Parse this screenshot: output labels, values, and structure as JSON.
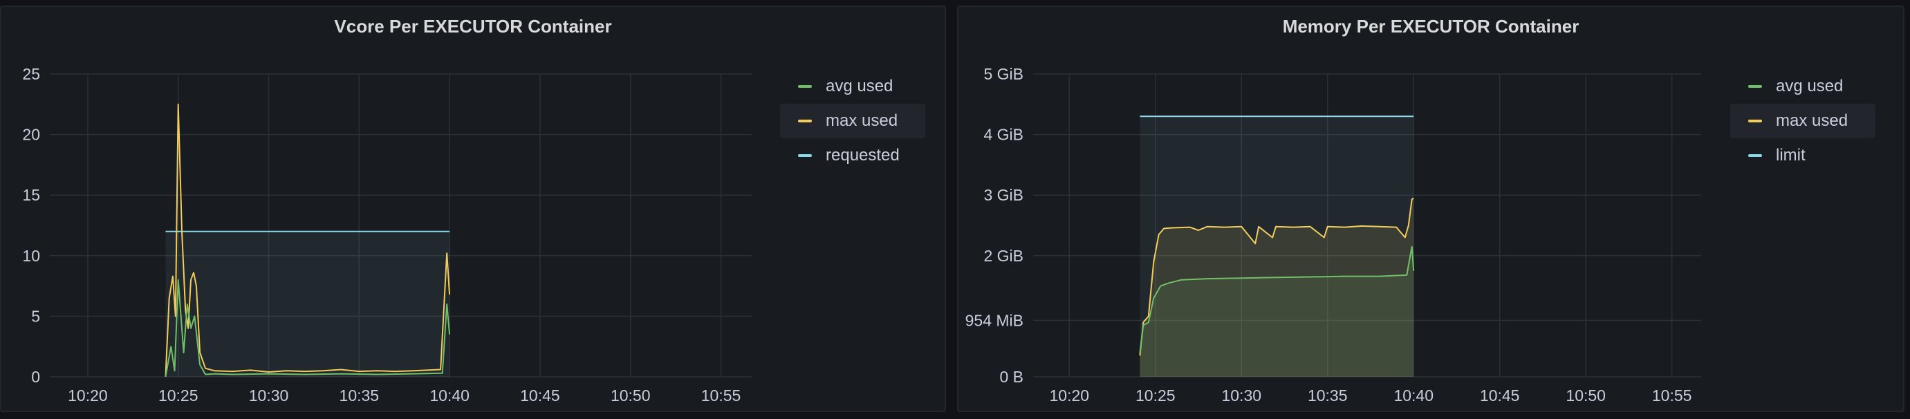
{
  "colors": {
    "avg": "#73bf69",
    "max": "#f2cc5c",
    "limit": "#8ad9e8",
    "grid": "#2c2f36",
    "text": "#ccccdc"
  },
  "chart_data": [
    {
      "type": "line",
      "title": "Vcore Per EXECUTOR Container",
      "xlabel": "",
      "ylabel": "",
      "x_ticks": [
        "10:20",
        "10:25",
        "10:30",
        "10:35",
        "10:40",
        "10:45",
        "10:50",
        "10:55"
      ],
      "y_ticks": [
        "0",
        "5",
        "10",
        "15",
        "20",
        "25"
      ],
      "ylim": [
        0,
        25
      ],
      "x_range_minutes": [
        10.2,
        10.25,
        10.3,
        10.35,
        10.4,
        10.45,
        10.5,
        10.55
      ],
      "legend_position": "right",
      "grid": true,
      "series": [
        {
          "name": "avg used",
          "color_key": "avg",
          "points": [
            [
              "10:24.3",
              0
            ],
            [
              "10:24.6",
              2.5
            ],
            [
              "10:24.8",
              0.5
            ],
            [
              "10:25.0",
              8
            ],
            [
              "10:25.3",
              2
            ],
            [
              "10:25.5",
              6
            ],
            [
              "10:25.7",
              4
            ],
            [
              "10:25.9",
              5
            ],
            [
              "10:26.2",
              1
            ],
            [
              "10:26.5",
              0.2
            ],
            [
              "10:27.0",
              0.25
            ],
            [
              "10:28.0",
              0.2
            ],
            [
              "10:30.0",
              0.25
            ],
            [
              "10:32.0",
              0.2
            ],
            [
              "10:34.0",
              0.25
            ],
            [
              "10:36.0",
              0.2
            ],
            [
              "10:38.0",
              0.25
            ],
            [
              "10:39.6",
              0.3
            ],
            [
              "10:39.85",
              6
            ],
            [
              "10:40.0",
              3.5
            ]
          ]
        },
        {
          "name": "max used",
          "color_key": "max",
          "points": [
            [
              "10:24.3",
              0
            ],
            [
              "10:24.5",
              6.5
            ],
            [
              "10:24.7",
              8.3
            ],
            [
              "10:24.85",
              5
            ],
            [
              "10:25.0",
              22.5
            ],
            [
              "10:25.2",
              12
            ],
            [
              "10:25.4",
              5.5
            ],
            [
              "10:25.55",
              4
            ],
            [
              "10:25.7",
              8
            ],
            [
              "10:25.85",
              8.6
            ],
            [
              "10:26.0",
              7.5
            ],
            [
              "10:26.2",
              2
            ],
            [
              "10:26.5",
              0.7
            ],
            [
              "10:27.0",
              0.5
            ],
            [
              "10:28.0",
              0.45
            ],
            [
              "10:29.0",
              0.55
            ],
            [
              "10:30.0",
              0.4
            ],
            [
              "10:31.0",
              0.5
            ],
            [
              "10:32.0",
              0.45
            ],
            [
              "10:33.0",
              0.5
            ],
            [
              "10:34.0",
              0.6
            ],
            [
              "10:35.0",
              0.45
            ],
            [
              "10:36.0",
              0.5
            ],
            [
              "10:37.0",
              0.45
            ],
            [
              "10:38.0",
              0.5
            ],
            [
              "10:39.5",
              0.6
            ],
            [
              "10:39.85",
              10.2
            ],
            [
              "10:40.0",
              6.8
            ]
          ]
        },
        {
          "name": "requested",
          "color_key": "limit",
          "fill": true,
          "points": [
            [
              "10:24.3",
              12
            ],
            [
              "10:40.0",
              12
            ]
          ]
        }
      ]
    },
    {
      "type": "line",
      "title": "Memory Per EXECUTOR Container",
      "xlabel": "",
      "ylabel": "",
      "x_ticks": [
        "10:20",
        "10:25",
        "10:30",
        "10:35",
        "10:40",
        "10:45",
        "10:50",
        "10:55"
      ],
      "y_ticks": [
        "0 B",
        "954 MiB",
        "2 GiB",
        "3 GiB",
        "4 GiB",
        "5 GiB"
      ],
      "ylim": [
        0,
        5
      ],
      "y_unit": "GiB",
      "legend_position": "right",
      "grid": true,
      "series": [
        {
          "name": "avg used",
          "color_key": "avg",
          "fill": true,
          "points": [
            [
              "10:24.1",
              0.4
            ],
            [
              "10:24.3",
              0.85
            ],
            [
              "10:24.6",
              0.9
            ],
            [
              "10:24.9",
              1.3
            ],
            [
              "10:25.3",
              1.5
            ],
            [
              "10:25.8",
              1.55
            ],
            [
              "10:26.5",
              1.6
            ],
            [
              "10:28.0",
              1.62
            ],
            [
              "10:30.0",
              1.63
            ],
            [
              "10:32.0",
              1.64
            ],
            [
              "10:34.0",
              1.65
            ],
            [
              "10:36.0",
              1.66
            ],
            [
              "10:38.0",
              1.66
            ],
            [
              "10:39.6",
              1.68
            ],
            [
              "10:39.9",
              2.15
            ],
            [
              "10:40.0",
              1.75
            ]
          ]
        },
        {
          "name": "max used",
          "color_key": "max",
          "fill": true,
          "points": [
            [
              "10:24.1",
              0.35
            ],
            [
              "10:24.3",
              0.9
            ],
            [
              "10:24.6",
              1.0
            ],
            [
              "10:24.9",
              1.9
            ],
            [
              "10:25.2",
              2.35
            ],
            [
              "10:25.5",
              2.45
            ],
            [
              "10:26.0",
              2.46
            ],
            [
              "10:27.0",
              2.47
            ],
            [
              "10:27.5",
              2.42
            ],
            [
              "10:28.0",
              2.48
            ],
            [
              "10:29.0",
              2.47
            ],
            [
              "10:30.0",
              2.48
            ],
            [
              "10:30.8",
              2.2
            ],
            [
              "10:31.0",
              2.48
            ],
            [
              "10:31.8",
              2.3
            ],
            [
              "10:32.0",
              2.48
            ],
            [
              "10:33.0",
              2.47
            ],
            [
              "10:34.0",
              2.48
            ],
            [
              "10:34.8",
              2.3
            ],
            [
              "10:35.0",
              2.48
            ],
            [
              "10:36.0",
              2.47
            ],
            [
              "10:37.0",
              2.49
            ],
            [
              "10:38.0",
              2.48
            ],
            [
              "10:39.0",
              2.47
            ],
            [
              "10:39.5",
              2.3
            ],
            [
              "10:39.7",
              2.5
            ],
            [
              "10:39.9",
              2.93
            ],
            [
              "10:40.0",
              2.95
            ]
          ]
        },
        {
          "name": "limit",
          "color_key": "limit",
          "fill": true,
          "points": [
            [
              "10:24.1",
              4.3
            ],
            [
              "10:40.0",
              4.3
            ]
          ]
        }
      ]
    }
  ],
  "panels": [
    {
      "title": "Vcore Per EXECUTOR Container",
      "legend": [
        "avg used",
        "max used",
        "requested"
      ]
    },
    {
      "title": "Memory Per EXECUTOR Container",
      "legend": [
        "avg used",
        "max used",
        "limit"
      ]
    }
  ]
}
